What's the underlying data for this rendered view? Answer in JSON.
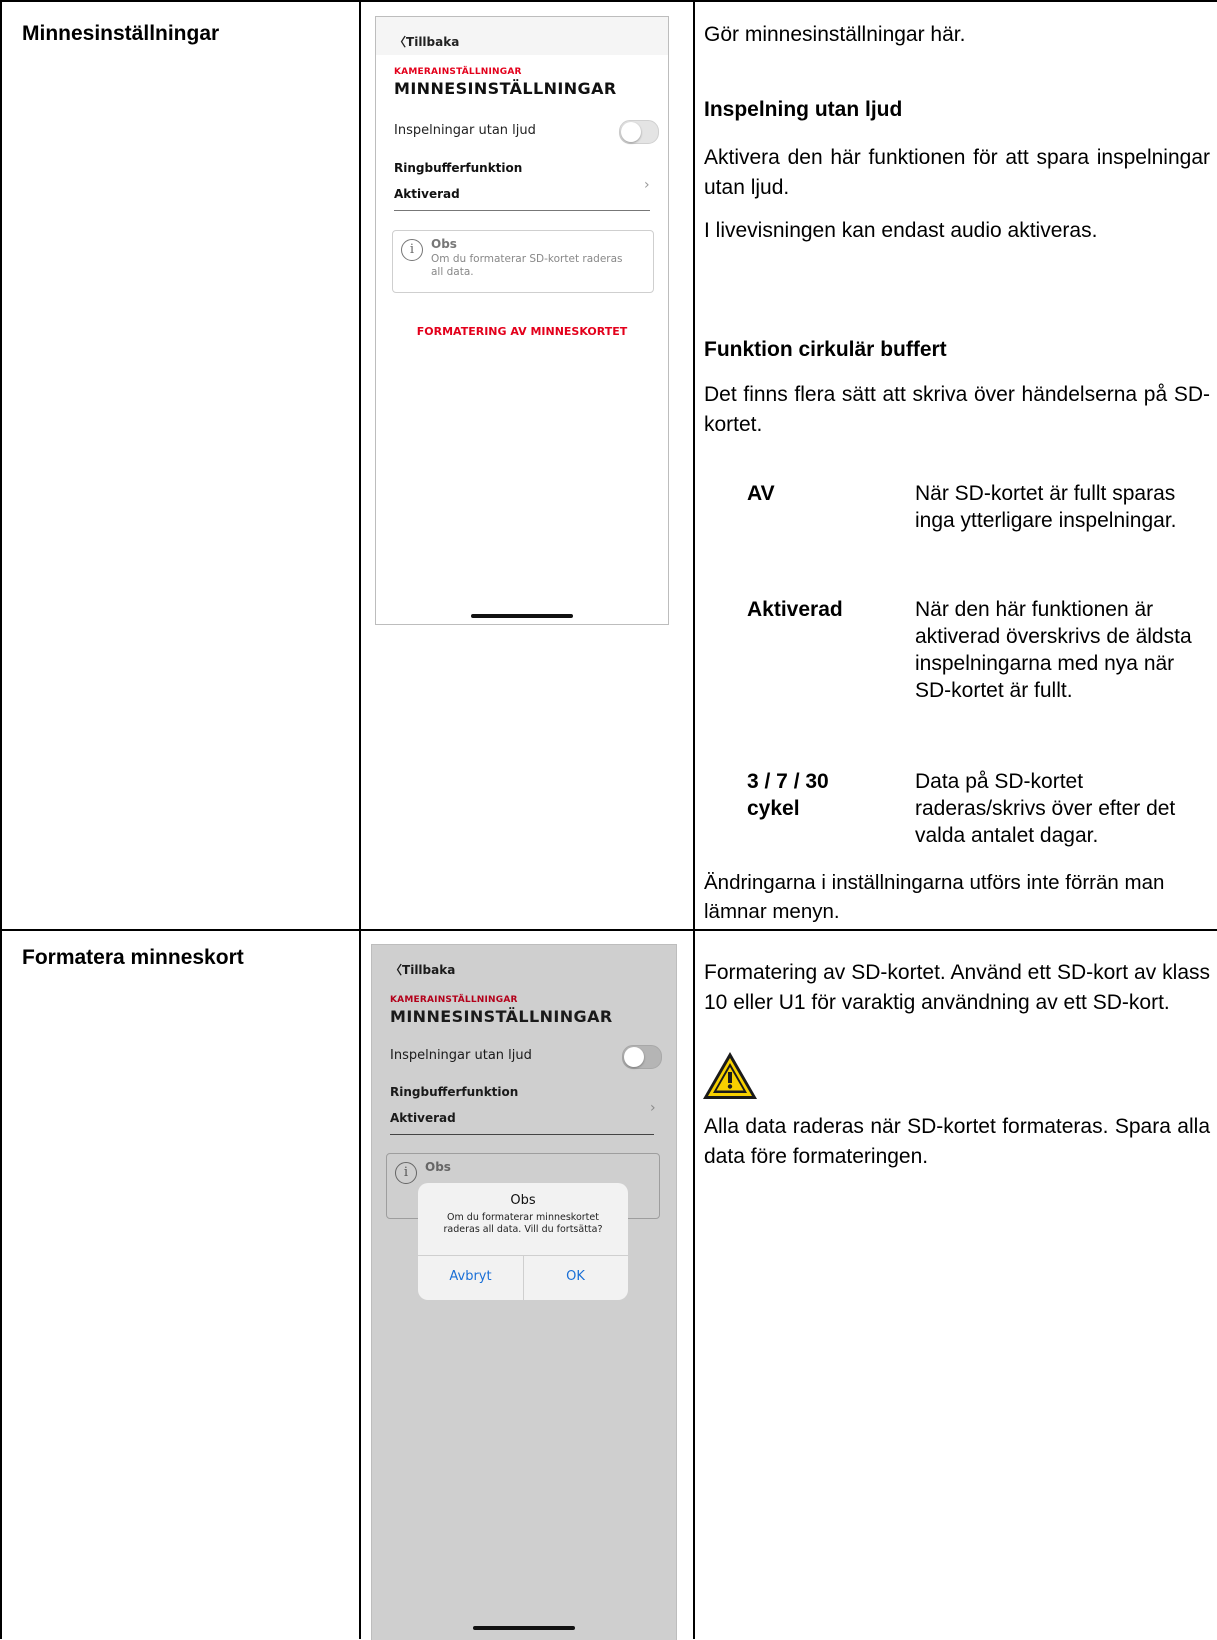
{
  "rows": [
    {
      "label": "Minnesinställningar",
      "phone": {
        "back": "Tillbaka",
        "subtitle": "KAMERAINSTÄLLNINGAR",
        "title": "MINNESINSTÄLLNINGAR",
        "audio_toggle_label": "Inspelningar utan ljud",
        "audio_toggle_on": false,
        "ringbuffer_label": "Ringbufferfunktion",
        "ringbuffer_value": "Aktiverad",
        "note_title": "Obs",
        "note_text": "Om du formaterar SD-kortet raderas all data.",
        "format_button": "FORMATERING AV MINNESKORTET"
      },
      "text": {
        "intro": "Gör minnesinställningar här.",
        "h_no_audio": "Inspelning utan ljud",
        "p_no_audio_1": "Aktivera den här funktionen för att spara inspelningar utan ljud.",
        "p_no_audio_2": "I livevisningen kan endast audio aktiveras.",
        "h_ring": "Funktion cirkulär buffert",
        "p_ring": "Det finns flera sätt att skriva över händelserna på SD-kortet.",
        "modes": [
          {
            "key": "AV",
            "desc": "När SD-kortet är fullt sparas inga ytterligare inspelningar."
          },
          {
            "key": "Aktiverad",
            "desc": "När den här funktionen är aktiverad överskrivs de äldsta inspelningarna med nya när SD-kortet är fullt."
          },
          {
            "key": "3 / 7 / 30 cykel",
            "desc": "Data på SD-kortet raderas/skrivs över efter det valda antalet dagar."
          }
        ],
        "outro": "Ändringarna i inställningarna utförs inte förrän man lämnar menyn."
      }
    },
    {
      "label": "Formatera minneskort",
      "phone": {
        "back": "Tillbaka",
        "subtitle": "KAMERAINSTÄLLNINGAR",
        "title": "MINNESINSTÄLLNINGAR",
        "audio_toggle_label": "Inspelningar utan ljud",
        "ringbuffer_label": "Ringbufferfunktion",
        "ringbuffer_value": "Aktiverad",
        "note_title": "Obs",
        "dialog": {
          "title": "Obs",
          "message": "Om du formaterar minneskortet raderas all data. Vill du fortsätta?",
          "cancel": "Avbryt",
          "ok": "OK"
        }
      },
      "text": {
        "intro": "Formatering av SD-kortet. Använd ett SD-kort av klass 10 eller U1 för varaktig användning av ett SD-kort.",
        "warning_icon": "warning-triangle-icon",
        "warning": "Alla data raderas när SD-kortet formateras. Spara alla data före formateringen."
      }
    }
  ],
  "colors": {
    "accent_red": "#e3001b",
    "link_blue": "#1a6fd6",
    "warning_yellow": "#f7d000"
  }
}
